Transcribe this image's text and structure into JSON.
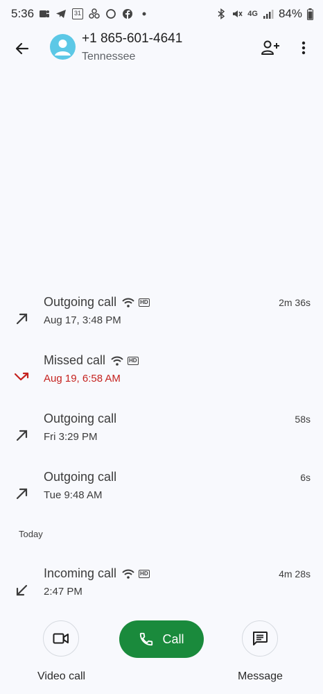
{
  "status_bar": {
    "time": "5:36",
    "left_icons": [
      "teams-icon",
      "telegram-icon",
      "calendar-31-icon",
      "pinwheel-icon",
      "circle-app-icon",
      "facebook-icon",
      "dot-icon"
    ],
    "calendar_day": "31",
    "right_icons": [
      "bluetooth-icon",
      "mute-vibrate-icon",
      "4g-icon",
      "signal-icon",
      "battery-icon"
    ],
    "network": "4G",
    "battery": "84%"
  },
  "header": {
    "phone_number": "+1 865-601-4641",
    "location": "Tennessee"
  },
  "calls": [
    {
      "type": "Outgoing call",
      "when": "Aug 17, 3:48 PM",
      "duration": "2m 36s",
      "direction": "outgoing",
      "wifi": true,
      "hd": true,
      "missed": false
    },
    {
      "type": "Missed call",
      "when": "Aug 19, 6:58 AM",
      "duration": "",
      "direction": "missed",
      "wifi": true,
      "hd": true,
      "missed": true
    },
    {
      "type": "Outgoing call",
      "when": "Fri 3:29 PM",
      "duration": "58s",
      "direction": "outgoing",
      "wifi": false,
      "hd": false,
      "missed": false
    },
    {
      "type": "Outgoing call",
      "when": "Tue 9:48 AM",
      "duration": "6s",
      "direction": "outgoing",
      "wifi": false,
      "hd": false,
      "missed": false
    }
  ],
  "today_label": "Today",
  "today_calls": [
    {
      "type": "Incoming call",
      "when": "2:47 PM",
      "duration": "4m 28s",
      "direction": "incoming",
      "wifi": true,
      "hd": true,
      "missed": false
    }
  ],
  "hd_label": "HD",
  "actions": {
    "video": "Video call",
    "call": "Call",
    "message": "Message"
  },
  "colors": {
    "background": "#f8f9fd",
    "avatar": "#5cc8e6",
    "call_button": "#1a8a3c",
    "missed": "#c5221f"
  }
}
